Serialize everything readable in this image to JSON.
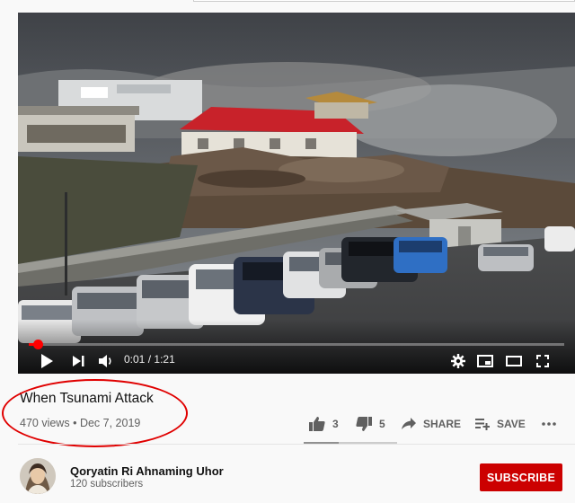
{
  "video": {
    "title": "When Tsunami Attack",
    "views": "470 views",
    "separator": "•",
    "date": "Dec 7, 2019",
    "progress_fraction": 0.0165
  },
  "player": {
    "time_current": "0:01",
    "time_separator": "/",
    "time_total": "1:21",
    "accent_color": "#ff0000"
  },
  "actions": {
    "like_count": "3",
    "dislike_count": "5",
    "share_label": "SHARE",
    "save_label": "SAVE",
    "like_fraction": 0.375
  },
  "channel": {
    "name": "Qoryatin Ri Ahnaming Uhor",
    "subscribers": "120 subscribers",
    "subscribe_label": "SUBSCRIBE",
    "subscribe_color": "#cc0000"
  },
  "annotation": {
    "color": "#e00000"
  },
  "icons": [
    "play-icon",
    "next-icon",
    "volume-icon",
    "settings-icon",
    "miniplayer-icon",
    "theater-icon",
    "fullscreen-icon",
    "thumbs-up-icon",
    "thumbs-down-icon",
    "share-icon",
    "add-to-playlist-icon",
    "more-icon"
  ]
}
